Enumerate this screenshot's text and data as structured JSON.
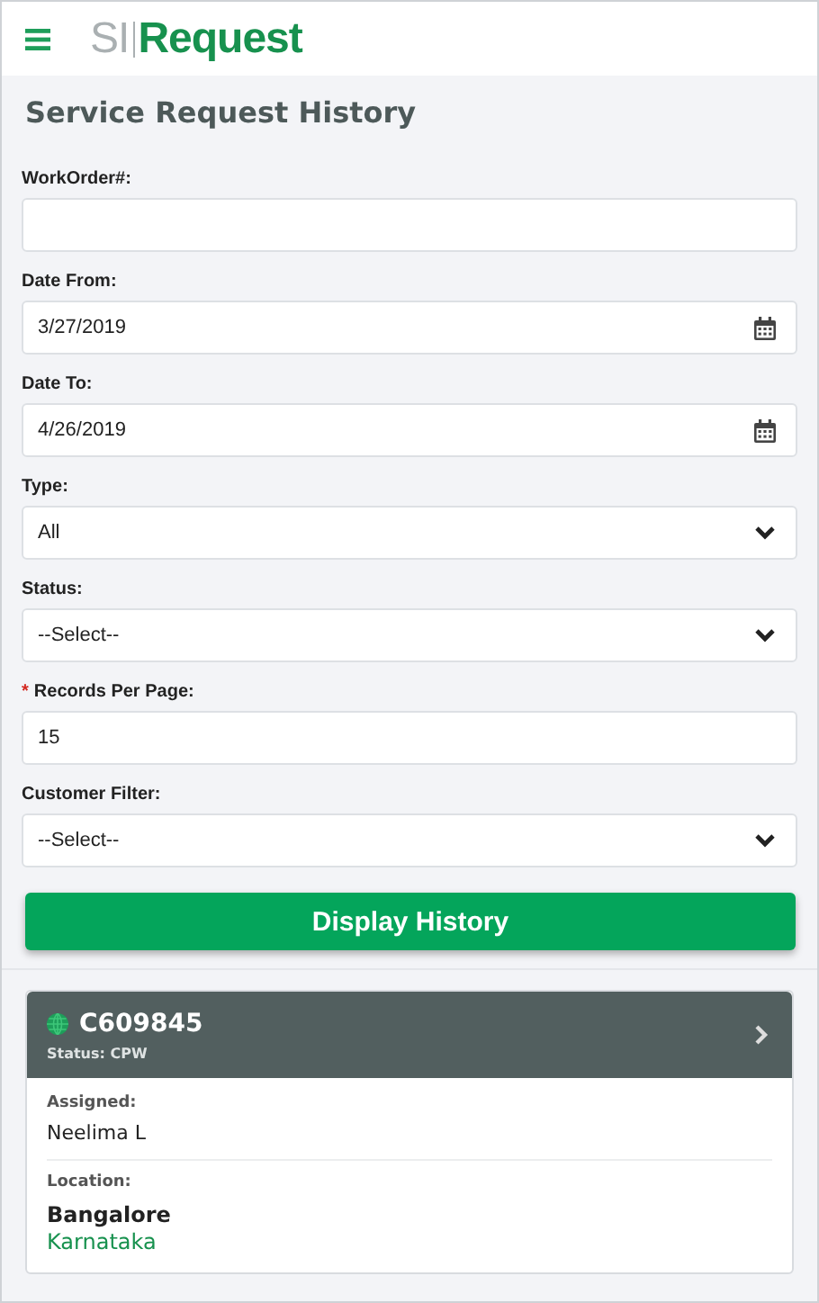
{
  "header": {
    "logo_prefix": "SI",
    "logo_name": "Request"
  },
  "title": "Service Request History",
  "fields": [
    {
      "kind": "text",
      "label": "WorkOrder#:",
      "required": false
    },
    {
      "kind": "date",
      "label": "Date From:",
      "required": false,
      "value": "3/27/2019"
    },
    {
      "kind": "date",
      "label": "Date To:",
      "required": false,
      "value": "4/26/2019"
    },
    {
      "kind": "select",
      "label": "Type:",
      "required": false,
      "value": "All"
    },
    {
      "kind": "select",
      "label": "Status:",
      "required": false,
      "value": "--Select--"
    },
    {
      "kind": "text",
      "label": "Records Per Page:",
      "required": true,
      "value": "15"
    },
    {
      "kind": "select",
      "label": "Customer Filter:",
      "required": false,
      "value": "--Select--"
    }
  ],
  "required_mark": "*",
  "button": "Display History",
  "results": [
    {
      "id": "C609845",
      "status": "Status: CPW",
      "assigned_label": "Assigned:",
      "assigned": "Neelima L",
      "location_label": "Location:",
      "city": "Bangalore",
      "state": "Karnataka"
    }
  ]
}
